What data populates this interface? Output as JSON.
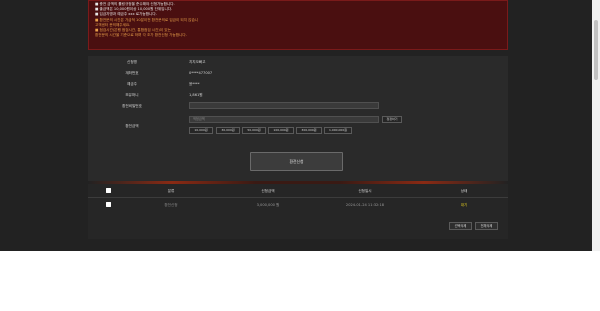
{
  "notice": {
    "lines": [
      {
        "text": "■ 충전 금액의 롤링규정을 준수해야 신청가능합니다.",
        "tone": "w"
      },
      {
        "text": "■ 출금액은 10,000원이상 10,000원 단위입니다.",
        "tone": "w"
      },
      {
        "text": "■ 입금자명과 예금주 xxx 로가능합니다.",
        "tone": "w"
      },
      {
        "text": "■ 환전문의 시간은 가급적 10분이전 환전문의로 입금이 되지 않습니",
        "tone": "o"
      },
      {
        "text": "   고객센터 문의해주세요.",
        "tone": "o"
      },
      {
        "text": "■ 점검시간(은행 점검시간, 통합점검 시간)이 있는",
        "tone": "o"
      },
      {
        "text": "   환전문의 시간을 기준으로 하며 각 조가 환전신청 가능합니다.",
        "tone": "o"
      }
    ]
  },
  "form": {
    "fields": [
      {
        "label": "신청명",
        "value": "지지오빠고"
      },
      {
        "label": "계좌번호",
        "value": "0****477007"
      },
      {
        "label": "예금주",
        "value": "윤****"
      },
      {
        "label": "보유머니",
        "value": "1,861원"
      }
    ],
    "password_label": "환전비밀번호",
    "amount_label": "환전금액",
    "amount_placeholder": "적정금액",
    "clear_label": "정정하기",
    "quick_amounts": [
      "10,000원",
      "30,000원",
      "50,000원",
      "100,000원",
      "300,000원",
      "1,000,000원"
    ],
    "apply_label": "환전신청"
  },
  "table": {
    "headers": [
      "분류",
      "신청금액",
      "신청일시",
      "상태"
    ],
    "rows": [
      {
        "type": "환전신청",
        "amount": "3,000,000 원",
        "datetime": "2024-01-24 11:32:18",
        "status": "대기"
      }
    ],
    "status_color": "#e8d020",
    "select_delete_label": "선택삭제",
    "delete_all_label": "전체삭제"
  }
}
